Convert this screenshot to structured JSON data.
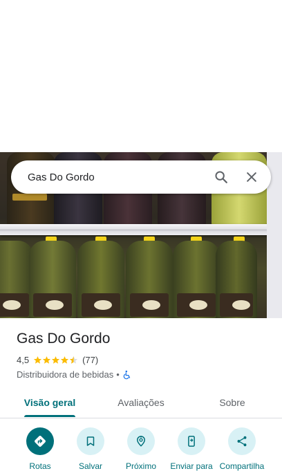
{
  "search": {
    "query": "Gas Do Gordo"
  },
  "place": {
    "name": "Gas Do Gordo",
    "rating": "4,5",
    "rating_value": 4.5,
    "review_count": "(77)",
    "category": "Distribuidora de bebidas",
    "separator": "•"
  },
  "tabs": [
    {
      "label": "Visão geral",
      "active": true
    },
    {
      "label": "Avaliações",
      "active": false
    },
    {
      "label": "Sobre",
      "active": false
    }
  ],
  "actions": [
    {
      "label": "Rotas",
      "icon": "directions-icon"
    },
    {
      "label": "Salvar",
      "icon": "bookmark-icon"
    },
    {
      "label": "Próximo",
      "icon": "nearby-icon"
    },
    {
      "label": "Enviar para",
      "icon": "send-to-phone-icon"
    },
    {
      "label": "Compartilha",
      "icon": "share-icon"
    }
  ],
  "colors": {
    "accent": "#00707a",
    "accent_light": "#d8f1f5",
    "star": "#fbbc04",
    "accessibility": "#1a73e8"
  }
}
